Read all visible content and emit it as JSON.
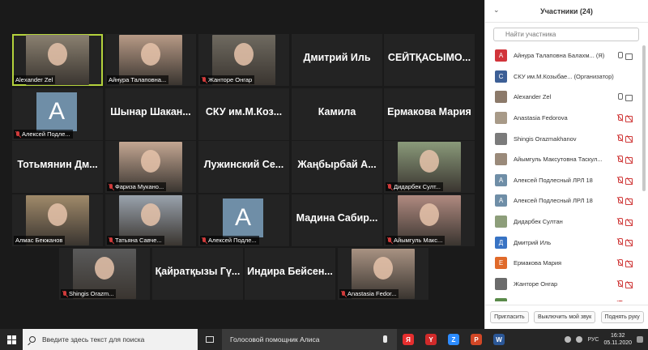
{
  "panel": {
    "title": "Участники (24)",
    "search_placeholder": "Найти участника",
    "participants": [
      {
        "avatar": "А",
        "color": "#d1343a",
        "name": "Айнура Талаповна Балахм... (Я)",
        "mic": "on",
        "cam": "on"
      },
      {
        "avatar": "С",
        "color": "#3d5f96",
        "name": "СКУ им.М.Козыбае... (Организатор)",
        "mic": "",
        "cam": ""
      },
      {
        "avatar": "",
        "color": "#8c7a6a",
        "name": "Alexander Zel",
        "mic": "on",
        "cam": "on"
      },
      {
        "avatar": "",
        "color": "#a89a88",
        "name": "Anastasia Fedorova",
        "mic": "off",
        "cam": "off"
      },
      {
        "avatar": "",
        "color": "#7b7b7b",
        "name": "Shingis Orazmakhanov",
        "mic": "off",
        "cam": "off"
      },
      {
        "avatar": "",
        "color": "#9a8a7a",
        "name": "Айымгуль Максутовна Таскул...",
        "mic": "off",
        "cam": "off"
      },
      {
        "avatar": "А",
        "color": "#6f8ea7",
        "name": "Алексей Подлесный ЛРЛ 18",
        "mic": "off",
        "cam": "off"
      },
      {
        "avatar": "А",
        "color": "#6f8ea7",
        "name": "Алексей Подлесный ЛРЛ 18",
        "mic": "off",
        "cam": "off"
      },
      {
        "avatar": "",
        "color": "#8d9e7a",
        "name": "Дидарбек Султан",
        "mic": "off",
        "cam": "off"
      },
      {
        "avatar": "Д",
        "color": "#3873c4",
        "name": "Дмитрий Иль",
        "mic": "off",
        "cam": "off"
      },
      {
        "avatar": "Е",
        "color": "#e06a2a",
        "name": "Ермакова Мария",
        "mic": "off",
        "cam": "off"
      },
      {
        "avatar": "",
        "color": "#6b6b6b",
        "name": "Жанторе Онгар",
        "mic": "off",
        "cam": "off"
      },
      {
        "avatar": "",
        "color": "#5a8a4a",
        "name": "",
        "mic": "off",
        "cam": "off"
      }
    ],
    "buttons": {
      "invite": "Пригласить",
      "mute_me": "Выключить мой звук",
      "raise_hand": "Поднять руку"
    }
  },
  "gallery": {
    "tiles": [
      {
        "kind": "photo",
        "label": "Alexander Zel",
        "muted": false,
        "selected": true,
        "color": "#8a8070"
      },
      {
        "kind": "photo",
        "label": "Айнура Талаповна...",
        "muted": false,
        "selected": false,
        "color": "#b79a86"
      },
      {
        "kind": "photo",
        "label": "Жанторе Онгар",
        "muted": true,
        "selected": false,
        "color": "#6f6a60"
      },
      {
        "kind": "name",
        "big": "Дмитрий Иль"
      },
      {
        "kind": "name",
        "big": "СЕЙТҚАСЫМО..."
      },
      {
        "kind": "avatar",
        "label": "Алексей Подле...",
        "muted": true
      },
      {
        "kind": "name",
        "big": "Шынар Шакан..."
      },
      {
        "kind": "name",
        "big": "СКУ им.М.Коз..."
      },
      {
        "kind": "name",
        "big": "Камила"
      },
      {
        "kind": "name",
        "big": "Ермакова Мария"
      },
      {
        "kind": "name",
        "big": "Тотьмянин Дм..."
      },
      {
        "kind": "photo",
        "label": "Фариза Мукано...",
        "muted": true,
        "selected": false,
        "color": "#c4a793"
      },
      {
        "kind": "name",
        "big": "Лужинский Се..."
      },
      {
        "kind": "name",
        "big": "Жаңбырбай А..."
      },
      {
        "kind": "photo",
        "label": "Дидарбек Султ...",
        "muted": true,
        "selected": false,
        "color": "#8a9a7a"
      },
      {
        "kind": "photo",
        "label": "Алмас Бекжанов",
        "muted": false,
        "selected": false,
        "color": "#a08a6a"
      },
      {
        "kind": "photo",
        "label": "Татьяна Савче...",
        "muted": true,
        "selected": false,
        "color": "#9aa3ad"
      },
      {
        "kind": "avatar",
        "label": "Алексей Подле...",
        "muted": true
      },
      {
        "kind": "name",
        "big": "Мадина Сабир..."
      },
      {
        "kind": "photo",
        "label": "Айымгуль Макс...",
        "muted": true,
        "selected": false,
        "color": "#b08a80"
      },
      {
        "kind": "photo",
        "label": "Shingis Orazm...",
        "muted": true,
        "selected": false,
        "color": "#5a5a5a"
      },
      {
        "kind": "name",
        "big": "Қайратқызы Гү..."
      },
      {
        "kind": "name",
        "big": "Индира Бейсен..."
      },
      {
        "kind": "photo",
        "label": "Anastasia Fedor...",
        "muted": true,
        "selected": false,
        "color": "#a89282"
      }
    ]
  },
  "taskbar": {
    "search_placeholder": "Введите здесь текст для поиска",
    "alice_label": "Голосовой помощник Алиса",
    "lang": "РУС",
    "time": "16:32",
    "date": "05.11.2020",
    "apps": [
      {
        "glyph": "Я",
        "color": "#e62e2e"
      },
      {
        "glyph": "Y",
        "color": "#d12a2a"
      },
      {
        "glyph": "Z",
        "color": "#2d8cff"
      },
      {
        "glyph": "P",
        "color": "#d24726"
      },
      {
        "glyph": "W",
        "color": "#2b5797"
      }
    ]
  }
}
